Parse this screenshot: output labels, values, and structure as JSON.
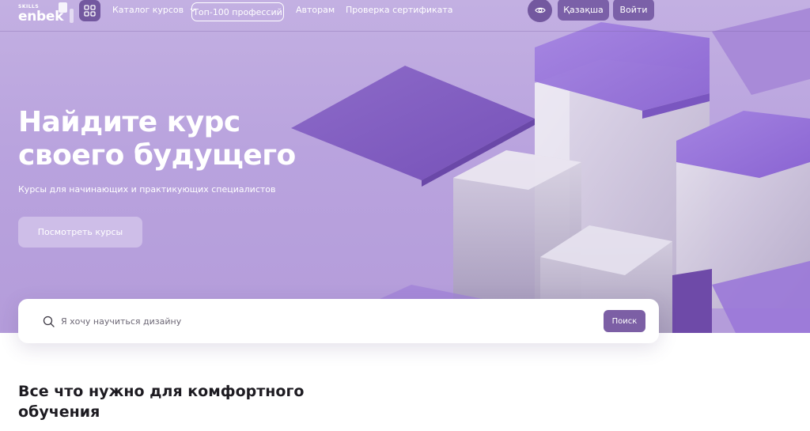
{
  "header": {
    "logo_top": "SKILLS",
    "logo_main": "enbek",
    "nav": {
      "catalog": "Каталог курсов",
      "top100": "Топ-100 профессий",
      "authors": "Авторам",
      "certificate": "Проверка сертификата"
    },
    "language": "Қазақша",
    "login": "Войти"
  },
  "hero": {
    "title_line1": "Найдите курс",
    "title_line2": "своего будущего",
    "subtitle": "Курсы для начинающих и практикующих специалистов",
    "cta": "Посмотреть курсы"
  },
  "search": {
    "placeholder": "Я хочу научиться дизайну",
    "button": "Поиск"
  },
  "section": {
    "title_line1": "Все что нужно для комфортного",
    "title_line2": "обучения"
  },
  "colors": {
    "hero_background": "#b9a3de",
    "accent": "#7c5fa5",
    "dark_purple": "#73589f"
  }
}
